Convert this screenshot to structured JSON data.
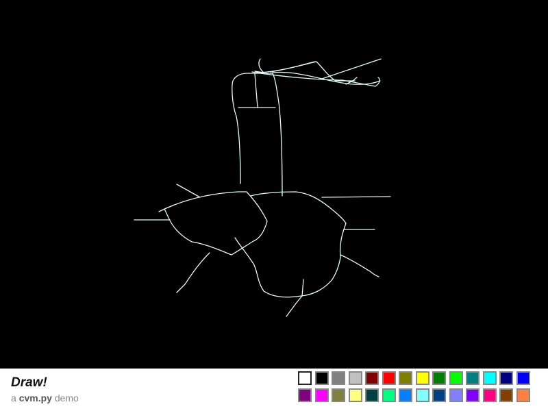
{
  "app": {
    "title": "Draw!",
    "subtitle_prefix": "a ",
    "subtitle_lib": "cvm.py",
    "subtitle_suffix": " demo"
  },
  "canvas": {
    "background": "#000000",
    "stroke_color": "#e0fff8"
  },
  "palette": {
    "selected": "#ffffff",
    "row1": [
      "#ffffff",
      "#000000",
      "#808080",
      "#c0c0c0",
      "#800000",
      "#ff0000",
      "#808000",
      "#ffff00",
      "#008000",
      "#00ff00",
      "#008080",
      "#00ffff",
      "#000080",
      "#0000ff"
    ],
    "row2": [
      "#800080",
      "#ff00ff",
      "#808040",
      "#ffff80",
      "#004040",
      "#00ff80",
      "#0080ff",
      "#80ffff",
      "#004080",
      "#8080ff",
      "#8000ff",
      "#ff0080",
      "#804000",
      "#ff8040"
    ]
  }
}
